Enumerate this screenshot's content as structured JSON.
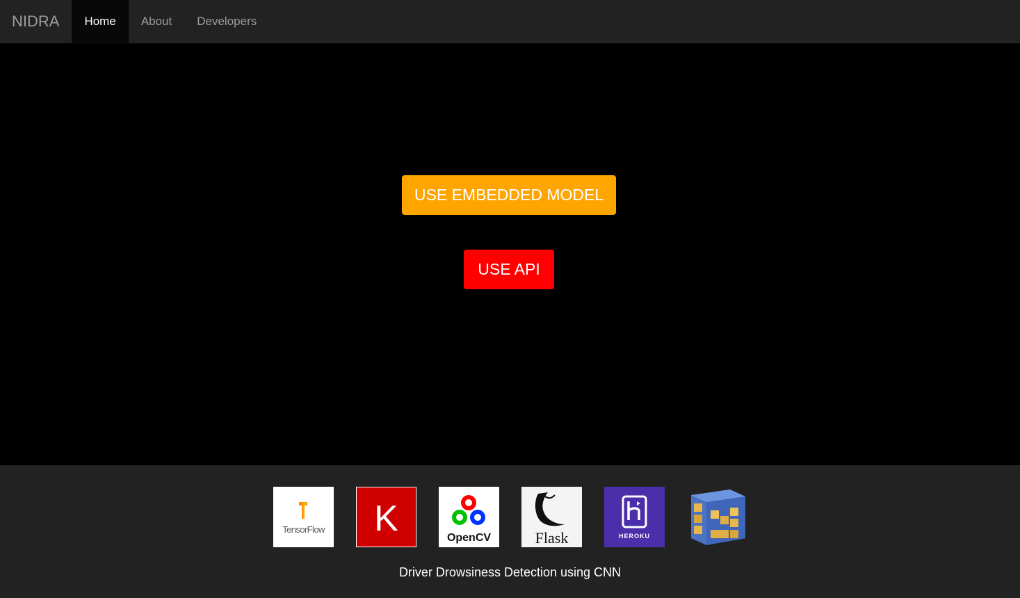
{
  "navbar": {
    "brand": "NIDRA",
    "items": [
      {
        "label": "Home",
        "active": true
      },
      {
        "label": "About",
        "active": false
      },
      {
        "label": "Developers",
        "active": false
      }
    ]
  },
  "main": {
    "embedded_button_label": "USE EMBEDDED MODEL",
    "api_button_label": "USE API"
  },
  "footer": {
    "logos": [
      {
        "name": "tensorflow-logo",
        "text": "TensorFlow"
      },
      {
        "name": "keras-logo",
        "text": "K"
      },
      {
        "name": "opencv-logo",
        "text": "OpenCV"
      },
      {
        "name": "flask-logo",
        "text": "Flask"
      },
      {
        "name": "heroku-logo",
        "text": "HEROKU"
      },
      {
        "name": "numpy-logo",
        "text": ""
      }
    ],
    "caption": "Driver Drowsiness Detection using CNN"
  },
  "colors": {
    "navbar_bg": "#222222",
    "active_bg": "#080808",
    "embedded_button": "#ffa500",
    "api_button": "#ff0000"
  }
}
